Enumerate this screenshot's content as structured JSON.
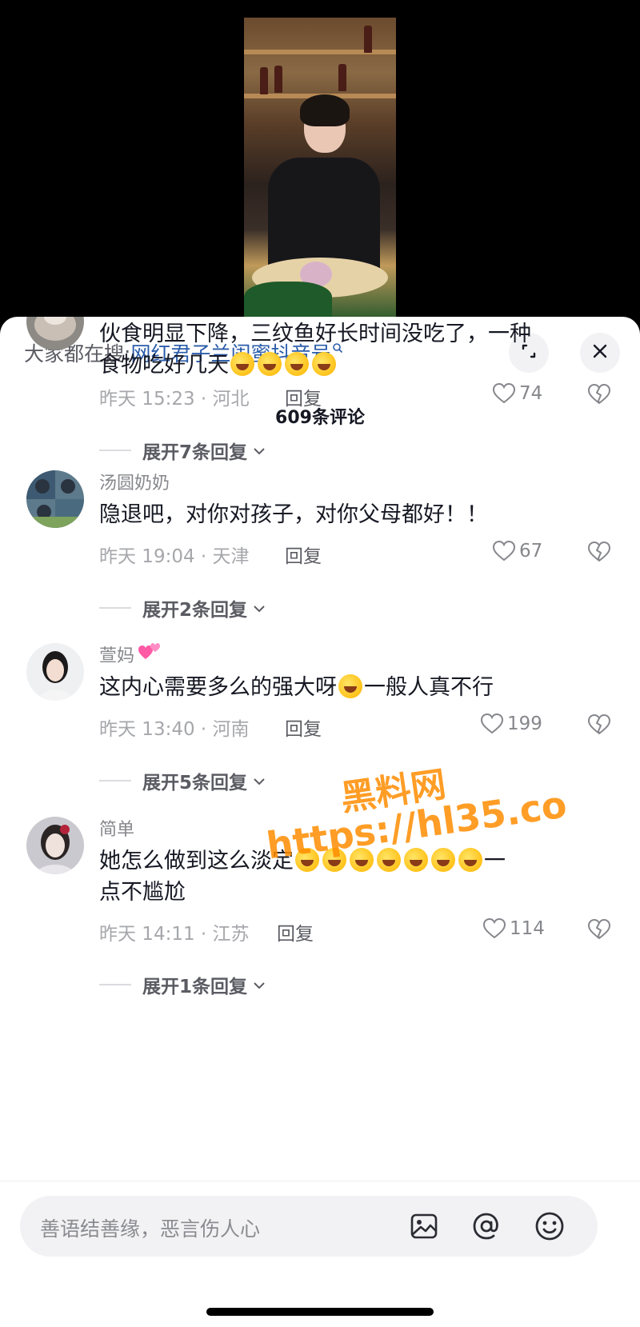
{
  "search": {
    "prefix": "大家都在搜:",
    "link": "网红君子兰闺蜜抖音号"
  },
  "comment_count": "609条评论",
  "comments": [
    {
      "user": "",
      "text_line1": "伙食明显下降，三纹鱼好长时间没吃了，一种",
      "text_line2": "食物吃好几天",
      "emoji_count": 4,
      "time_location": "昨天 15:23 · 河北",
      "reply_label": "回复",
      "likes": "74",
      "expand": "展开7条回复"
    },
    {
      "user": "汤圆奶奶",
      "text_line1": "隐退吧，对你对孩子，对你父母都好！！",
      "time_location": "昨天 19:04 · 天津",
      "reply_label": "回复",
      "likes": "67",
      "expand": "展开2条回复"
    },
    {
      "user": "萱妈",
      "text_before": "这内心需要多么的强大呀",
      "text_after": "一般人真不行",
      "time_location": "昨天 13:40 · 河南",
      "reply_label": "回复",
      "likes": "199",
      "expand": "展开5条回复"
    },
    {
      "user": "简单",
      "text_before": "她怎么做到这么淡定",
      "text_after": "一",
      "text_line2": "点不尴尬",
      "emoji_count": 7,
      "time_location": "昨天 14:11 · 江苏",
      "reply_label": "回复",
      "likes": "114",
      "expand": "展开1条回复"
    }
  ],
  "watermark": {
    "line1": "黑料网",
    "line2": "https://hl35.co"
  },
  "input": {
    "placeholder": "善语结善缘，恶言伤人心"
  },
  "colors": {
    "link": "#2a5caa",
    "watermark": "#ff8c00",
    "sheet_bg": "#ffffff"
  },
  "icons": [
    "search-icon",
    "expand-icon",
    "close-icon",
    "heart-icon",
    "dislike-icon",
    "image-icon",
    "at-icon",
    "emoji-icon",
    "chevron-down-icon"
  ]
}
